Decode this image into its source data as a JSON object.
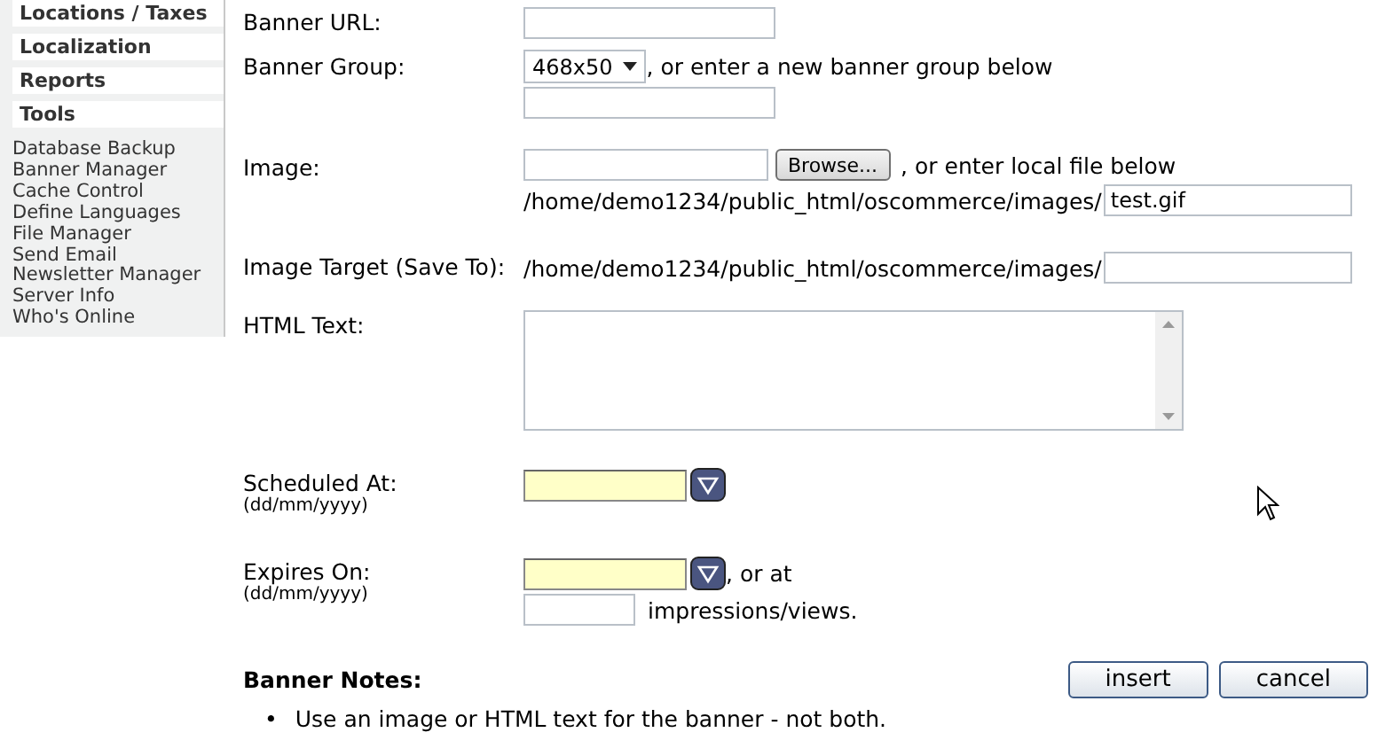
{
  "sidebar": {
    "sections": [
      "Locations / Taxes",
      "Localization",
      "Reports",
      "Tools"
    ],
    "links": [
      "Database Backup",
      "Banner Manager",
      "Cache Control",
      "Define Languages",
      "File Manager",
      "Send Email",
      "Newsletter Manager",
      "Server Info",
      "Who's Online"
    ]
  },
  "form": {
    "fields": [
      {
        "kind": "text",
        "label": "Banner URL:"
      },
      {
        "kind": "group",
        "label": "Banner Group:",
        "select": "468x50",
        "note": ", or enter a new banner group below"
      },
      {
        "kind": "image",
        "label": "Image:",
        "browse": "Browse...",
        "note": ", or enter local file below",
        "path": "/home/demo1234/public_html/oscommerce/images/",
        "value": "test.gif"
      },
      {
        "kind": "target",
        "label": "Image Target (Save To):",
        "path": "/home/demo1234/public_html/oscommerce/images/"
      },
      {
        "kind": "textarea",
        "label": "HTML Text:"
      },
      {
        "kind": "date",
        "label": "Scheduled At:",
        "hint": "(dd/mm/yyyy)"
      },
      {
        "kind": "expires",
        "label": "Expires On:",
        "hint": "(dd/mm/yyyy)",
        "note": ", or at",
        "impressions": "impressions/views."
      }
    ]
  },
  "notes": {
    "title": "Banner Notes:",
    "bullet": "•",
    "items": [
      "Use an image or HTML text for the banner - not both."
    ]
  },
  "buttons": [
    "insert",
    "cancel"
  ]
}
